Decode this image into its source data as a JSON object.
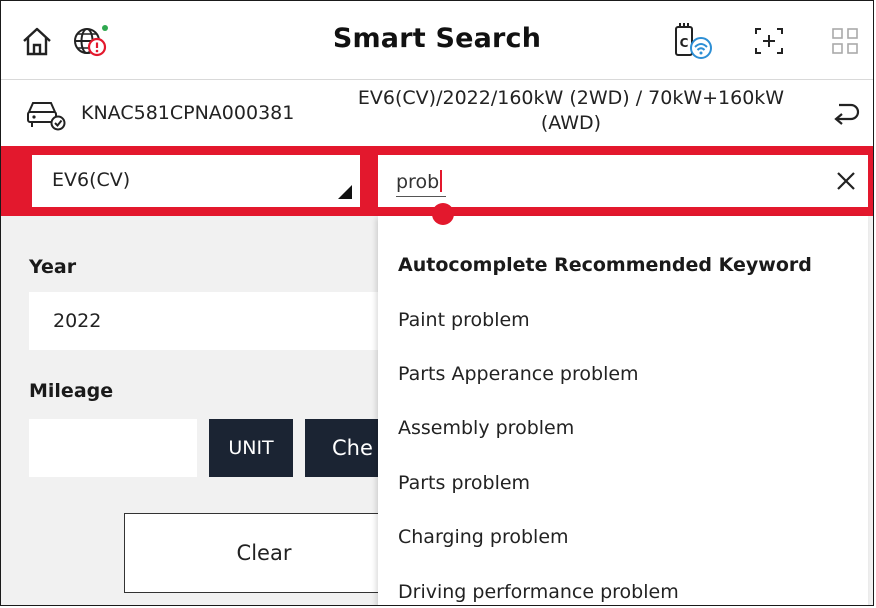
{
  "header": {
    "title": "Smart Search",
    "icons": [
      "home-icon",
      "globe-warning-icon",
      "vci-wireless-icon",
      "scan-icon",
      "grid-menu-icon"
    ],
    "colors": {
      "status_dot": "#2fa84f",
      "warning": "#e3182d",
      "wireless": "#2d8fd5"
    }
  },
  "vehicle": {
    "vin": "KNAC581CPNA000381",
    "description": "EV6(CV)/2022/160kW (2WD) / 70kW+160kW (AWD)"
  },
  "search": {
    "model_value": "EV6(CV)",
    "typed_text": "prob",
    "accent_color": "#e3182d"
  },
  "form": {
    "year_label": "Year",
    "year_value": "2022",
    "mileage_label": "Mileage",
    "mileage_value": "",
    "unit_label": "UNIT",
    "check_label": "Che",
    "clear_label": "Clear",
    "button_color": "#1b2433"
  },
  "autocomplete": {
    "header": "Autocomplete Recommended Keyword",
    "items": [
      "Paint problem",
      "Parts Apperance problem",
      "Assembly problem",
      "Parts problem",
      "Charging problem",
      "Driving performance problem"
    ]
  }
}
